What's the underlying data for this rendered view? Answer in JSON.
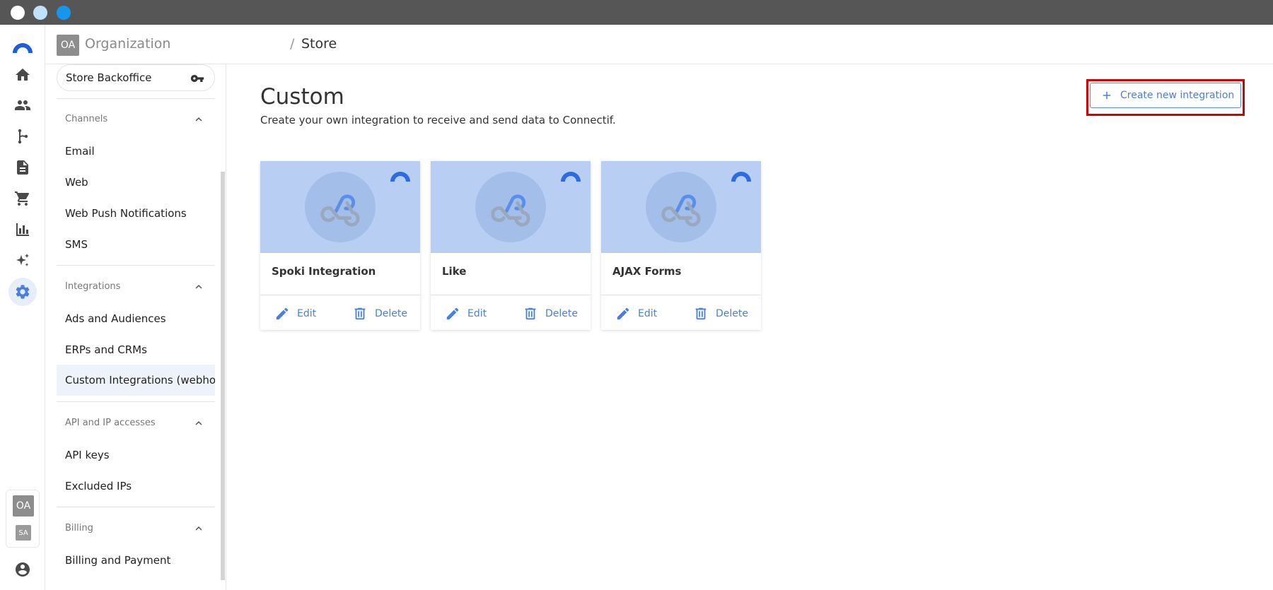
{
  "window": {
    "controls": [
      "close",
      "minimize",
      "maximize"
    ]
  },
  "topbar": {
    "org_initials": "OA",
    "org_name": "Organization",
    "separator": "/",
    "crumb": "Store"
  },
  "rail": {
    "items": [
      "home-icon",
      "contacts-icon",
      "workflows-icon",
      "content-icon",
      "cart-icon",
      "reports-icon",
      "ai-sparkle-icon",
      "settings-icon"
    ],
    "active": "settings-icon",
    "account_primary": "OA",
    "account_secondary": "SA"
  },
  "sidebar": {
    "store_selector": "Store Backoffice",
    "sections": [
      {
        "heading": "Channels",
        "items": [
          "Email",
          "Web",
          "Web Push Notifications",
          "SMS"
        ]
      },
      {
        "heading": "Integrations",
        "items": [
          "Ads and Audiences",
          "ERPs and CRMs",
          "Custom Integrations (webhooks)"
        ]
      },
      {
        "heading": "API and IP accesses",
        "items": [
          "API keys",
          "Excluded IPs"
        ]
      },
      {
        "heading": "Billing",
        "items": [
          "Billing and Payment"
        ]
      }
    ],
    "active_item": "Custom Integrations (webhooks)"
  },
  "main": {
    "title": "Custom",
    "subtitle": "Create your own integration to receive and send data to Connectif.",
    "create_button": "Create new integration",
    "cards": [
      {
        "name": "Spoki Integration",
        "edit": "Edit",
        "delete": "Delete"
      },
      {
        "name": "Like",
        "edit": "Edit",
        "delete": "Delete"
      },
      {
        "name": "AJAX Forms",
        "edit": "Edit",
        "delete": "Delete"
      }
    ]
  },
  "colors": {
    "accent": "#4a7fe0",
    "highlight_outline": "#d40000",
    "card_thumb": "#b8cff3",
    "titlebar": "#565656"
  }
}
